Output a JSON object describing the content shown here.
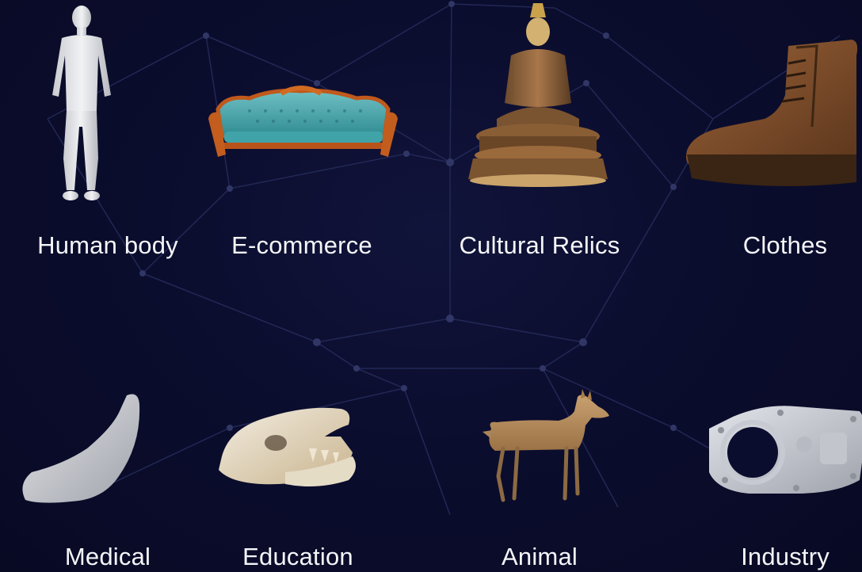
{
  "categories": [
    {
      "label": "Human body",
      "icon": "human-body-model-icon"
    },
    {
      "label": "E-commerce",
      "icon": "sofa-model-icon"
    },
    {
      "label": "Cultural Relics",
      "icon": "buddha-statue-icon"
    },
    {
      "label": "Clothes",
      "icon": "boot-model-icon"
    },
    {
      "label": "Medical",
      "icon": "foot-model-icon"
    },
    {
      "label": "Education",
      "icon": "skull-model-icon"
    },
    {
      "label": "Animal",
      "icon": "deer-model-icon"
    },
    {
      "label": "Industry",
      "icon": "gear-housing-model-icon"
    }
  ],
  "colors": {
    "background": "#0a0c2a",
    "network_line": "#2a3060",
    "label": "#f4f5f8"
  }
}
